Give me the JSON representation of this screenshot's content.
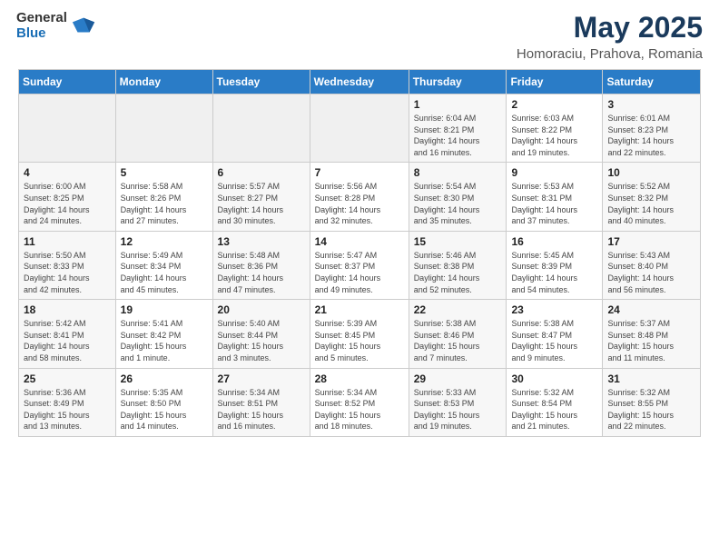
{
  "logo": {
    "general": "General",
    "blue": "Blue"
  },
  "title": "May 2025",
  "location": "Homoraciu, Prahova, Romania",
  "days_header": [
    "Sunday",
    "Monday",
    "Tuesday",
    "Wednesday",
    "Thursday",
    "Friday",
    "Saturday"
  ],
  "weeks": [
    [
      {
        "day": "",
        "info": ""
      },
      {
        "day": "",
        "info": ""
      },
      {
        "day": "",
        "info": ""
      },
      {
        "day": "",
        "info": ""
      },
      {
        "day": "1",
        "info": "Sunrise: 6:04 AM\nSunset: 8:21 PM\nDaylight: 14 hours\nand 16 minutes."
      },
      {
        "day": "2",
        "info": "Sunrise: 6:03 AM\nSunset: 8:22 PM\nDaylight: 14 hours\nand 19 minutes."
      },
      {
        "day": "3",
        "info": "Sunrise: 6:01 AM\nSunset: 8:23 PM\nDaylight: 14 hours\nand 22 minutes."
      }
    ],
    [
      {
        "day": "4",
        "info": "Sunrise: 6:00 AM\nSunset: 8:25 PM\nDaylight: 14 hours\nand 24 minutes."
      },
      {
        "day": "5",
        "info": "Sunrise: 5:58 AM\nSunset: 8:26 PM\nDaylight: 14 hours\nand 27 minutes."
      },
      {
        "day": "6",
        "info": "Sunrise: 5:57 AM\nSunset: 8:27 PM\nDaylight: 14 hours\nand 30 minutes."
      },
      {
        "day": "7",
        "info": "Sunrise: 5:56 AM\nSunset: 8:28 PM\nDaylight: 14 hours\nand 32 minutes."
      },
      {
        "day": "8",
        "info": "Sunrise: 5:54 AM\nSunset: 8:30 PM\nDaylight: 14 hours\nand 35 minutes."
      },
      {
        "day": "9",
        "info": "Sunrise: 5:53 AM\nSunset: 8:31 PM\nDaylight: 14 hours\nand 37 minutes."
      },
      {
        "day": "10",
        "info": "Sunrise: 5:52 AM\nSunset: 8:32 PM\nDaylight: 14 hours\nand 40 minutes."
      }
    ],
    [
      {
        "day": "11",
        "info": "Sunrise: 5:50 AM\nSunset: 8:33 PM\nDaylight: 14 hours\nand 42 minutes."
      },
      {
        "day": "12",
        "info": "Sunrise: 5:49 AM\nSunset: 8:34 PM\nDaylight: 14 hours\nand 45 minutes."
      },
      {
        "day": "13",
        "info": "Sunrise: 5:48 AM\nSunset: 8:36 PM\nDaylight: 14 hours\nand 47 minutes."
      },
      {
        "day": "14",
        "info": "Sunrise: 5:47 AM\nSunset: 8:37 PM\nDaylight: 14 hours\nand 49 minutes."
      },
      {
        "day": "15",
        "info": "Sunrise: 5:46 AM\nSunset: 8:38 PM\nDaylight: 14 hours\nand 52 minutes."
      },
      {
        "day": "16",
        "info": "Sunrise: 5:45 AM\nSunset: 8:39 PM\nDaylight: 14 hours\nand 54 minutes."
      },
      {
        "day": "17",
        "info": "Sunrise: 5:43 AM\nSunset: 8:40 PM\nDaylight: 14 hours\nand 56 minutes."
      }
    ],
    [
      {
        "day": "18",
        "info": "Sunrise: 5:42 AM\nSunset: 8:41 PM\nDaylight: 14 hours\nand 58 minutes."
      },
      {
        "day": "19",
        "info": "Sunrise: 5:41 AM\nSunset: 8:42 PM\nDaylight: 15 hours\nand 1 minute."
      },
      {
        "day": "20",
        "info": "Sunrise: 5:40 AM\nSunset: 8:44 PM\nDaylight: 15 hours\nand 3 minutes."
      },
      {
        "day": "21",
        "info": "Sunrise: 5:39 AM\nSunset: 8:45 PM\nDaylight: 15 hours\nand 5 minutes."
      },
      {
        "day": "22",
        "info": "Sunrise: 5:38 AM\nSunset: 8:46 PM\nDaylight: 15 hours\nand 7 minutes."
      },
      {
        "day": "23",
        "info": "Sunrise: 5:38 AM\nSunset: 8:47 PM\nDaylight: 15 hours\nand 9 minutes."
      },
      {
        "day": "24",
        "info": "Sunrise: 5:37 AM\nSunset: 8:48 PM\nDaylight: 15 hours\nand 11 minutes."
      }
    ],
    [
      {
        "day": "25",
        "info": "Sunrise: 5:36 AM\nSunset: 8:49 PM\nDaylight: 15 hours\nand 13 minutes."
      },
      {
        "day": "26",
        "info": "Sunrise: 5:35 AM\nSunset: 8:50 PM\nDaylight: 15 hours\nand 14 minutes."
      },
      {
        "day": "27",
        "info": "Sunrise: 5:34 AM\nSunset: 8:51 PM\nDaylight: 15 hours\nand 16 minutes."
      },
      {
        "day": "28",
        "info": "Sunrise: 5:34 AM\nSunset: 8:52 PM\nDaylight: 15 hours\nand 18 minutes."
      },
      {
        "day": "29",
        "info": "Sunrise: 5:33 AM\nSunset: 8:53 PM\nDaylight: 15 hours\nand 19 minutes."
      },
      {
        "day": "30",
        "info": "Sunrise: 5:32 AM\nSunset: 8:54 PM\nDaylight: 15 hours\nand 21 minutes."
      },
      {
        "day": "31",
        "info": "Sunrise: 5:32 AM\nSunset: 8:55 PM\nDaylight: 15 hours\nand 22 minutes."
      }
    ]
  ]
}
